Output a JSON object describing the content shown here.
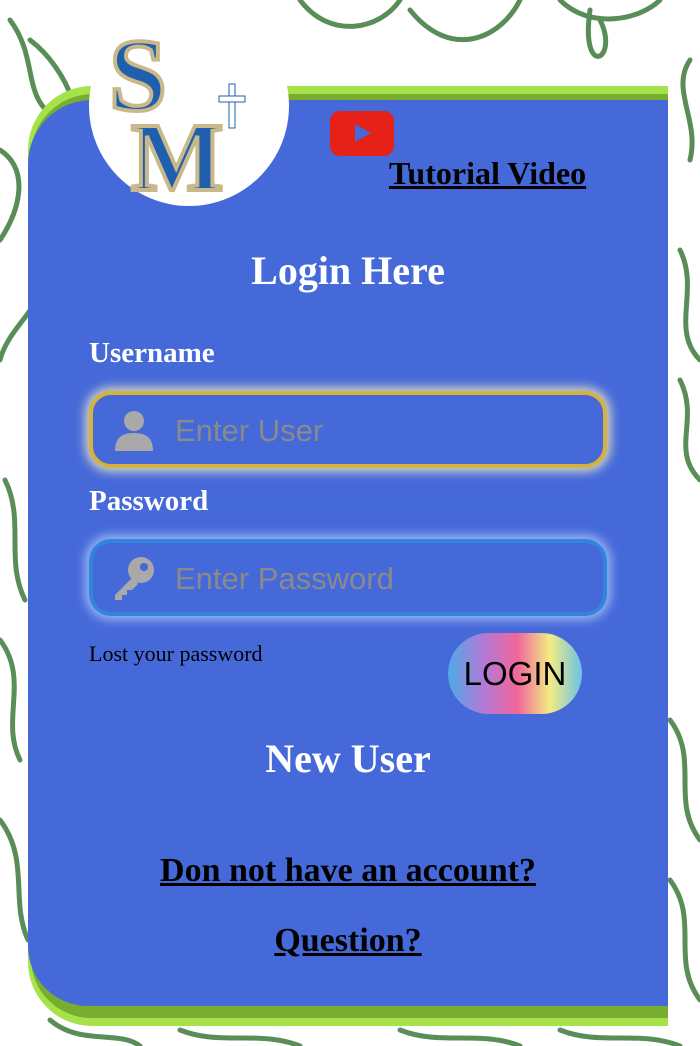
{
  "header": {
    "logo_text": "SM",
    "tutorial_link": "Tutorial Video",
    "video_icon": "youtube-play-icon"
  },
  "login": {
    "title": "Login Here",
    "username_label": "Username",
    "username_placeholder": "Enter User",
    "username_icon": "user-icon",
    "password_label": "Password",
    "password_placeholder": "Enter Password",
    "password_icon": "key-icon",
    "lost_password": "Lost your password",
    "login_button": "LOGIN"
  },
  "register": {
    "title": "New User",
    "no_account_link": "Don not have an account?",
    "question_link": "Question?"
  },
  "colors": {
    "card": "#4569d9",
    "frame_green": "#a6e34a",
    "doodle_green": "#3d7a3a",
    "video_red": "#e62117",
    "logo_blue": "#1f5fae",
    "logo_gold": "#c9b98a"
  }
}
